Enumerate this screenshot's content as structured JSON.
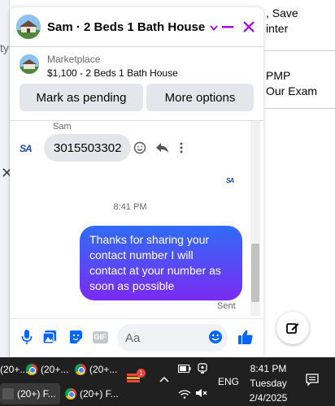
{
  "background": {
    "right_lines": [
      ", Save",
      "inter",
      "PMP",
      "Our Exam"
    ],
    "left_fragment": "ty"
  },
  "chat": {
    "title": "Sam · 2 Beds 1 Bath House",
    "listing": {
      "source": "Marketplace",
      "title": "$1,100 - 2 Beds 1 Bath House",
      "pending_button": "Mark as pending",
      "more_button": "More options"
    },
    "messages": {
      "sender": "Sam",
      "incoming_text": "3015503302",
      "avatar_text": "SA",
      "timestamp": "8:41 PM",
      "outgoing_text": "Thanks for sharing your contact number I will contact at your number as soon as possible",
      "status": "Sent"
    },
    "composer": {
      "placeholder": "Aa",
      "gif_label": "GIF"
    },
    "accent_color": "#a100ff",
    "bubble_gradient": [
      "#2f6cf6",
      "#7b2bf2"
    ],
    "like_color": "#0866ff"
  },
  "taskbar": {
    "apps_top": [
      "(20+...",
      "(20+...",
      "(20+..."
    ],
    "apps_bottom": [
      "(20+) F...",
      "(20+) F..."
    ],
    "badge_count": "1",
    "language": "ENG",
    "time": "8:41 PM",
    "day": "Tuesday",
    "date": "2/4/2025"
  }
}
